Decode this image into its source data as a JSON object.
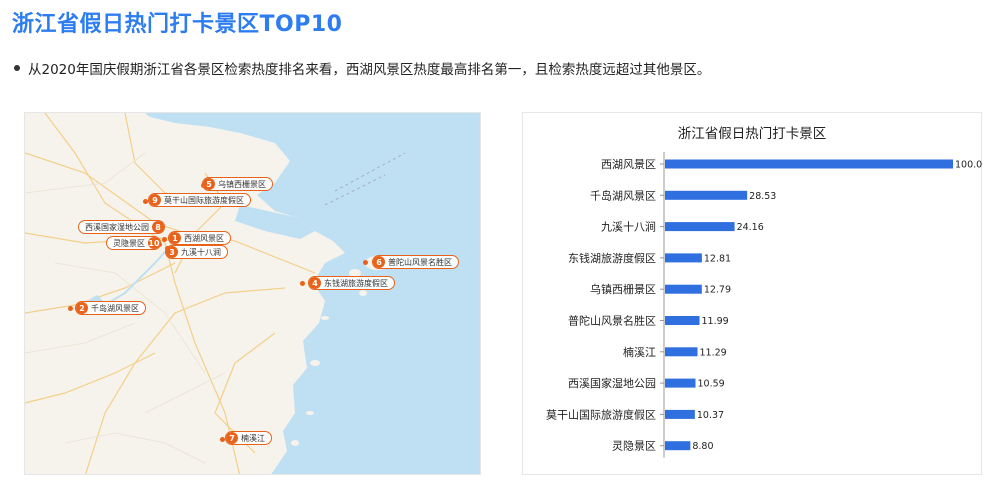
{
  "page": {
    "title": "浙江省假日热门打卡景区TOP10",
    "summary": "从2020年国庆假期浙江省各景区检索热度排名来看，西湖风景区热度最高排名第一，且检索热度远超过其他景区。"
  },
  "colors": {
    "title": "#2d7df0",
    "bar": "#2f6fe0",
    "marker": "#e8621a",
    "sea": "#bfe0f3",
    "land": "#f6f3ec"
  },
  "map": {
    "markers": [
      {
        "rank": "1",
        "name": "西湖风景区"
      },
      {
        "rank": "2",
        "name": "千岛湖风景区"
      },
      {
        "rank": "3",
        "name": "九溪十八涧"
      },
      {
        "rank": "4",
        "name": "东钱湖旅游度假区"
      },
      {
        "rank": "5",
        "name": "乌镇西栅景区"
      },
      {
        "rank": "6",
        "name": "普陀山风景名胜区"
      },
      {
        "rank": "7",
        "name": "楠溪江"
      },
      {
        "rank": "8",
        "name": "西溪国家湿地公园"
      },
      {
        "rank": "9",
        "name": "莫干山国际旅游度假区"
      },
      {
        "rank": "10",
        "name": "灵隐景区"
      }
    ]
  },
  "chart_data": {
    "type": "bar",
    "orientation": "horizontal",
    "title": "浙江省假日热门打卡景区",
    "categories": [
      "西湖风景区",
      "千岛湖风景区",
      "九溪十八涧",
      "东钱湖旅游度假区",
      "乌镇西栅景区",
      "普陀山风景名胜区",
      "楠溪江",
      "西溪国家湿地公园",
      "莫干山国际旅游度假区",
      "灵隐景区"
    ],
    "values": [
      100.0,
      28.53,
      24.16,
      12.81,
      12.79,
      11.99,
      11.29,
      10.59,
      10.37,
      8.8
    ],
    "value_labels": [
      "100.00",
      "28.53",
      "24.16",
      "12.81",
      "12.79",
      "11.99",
      "11.29",
      "10.59",
      "10.37",
      "8.80"
    ],
    "xlim": [
      0,
      100
    ],
    "grid": false,
    "legend": "none"
  }
}
